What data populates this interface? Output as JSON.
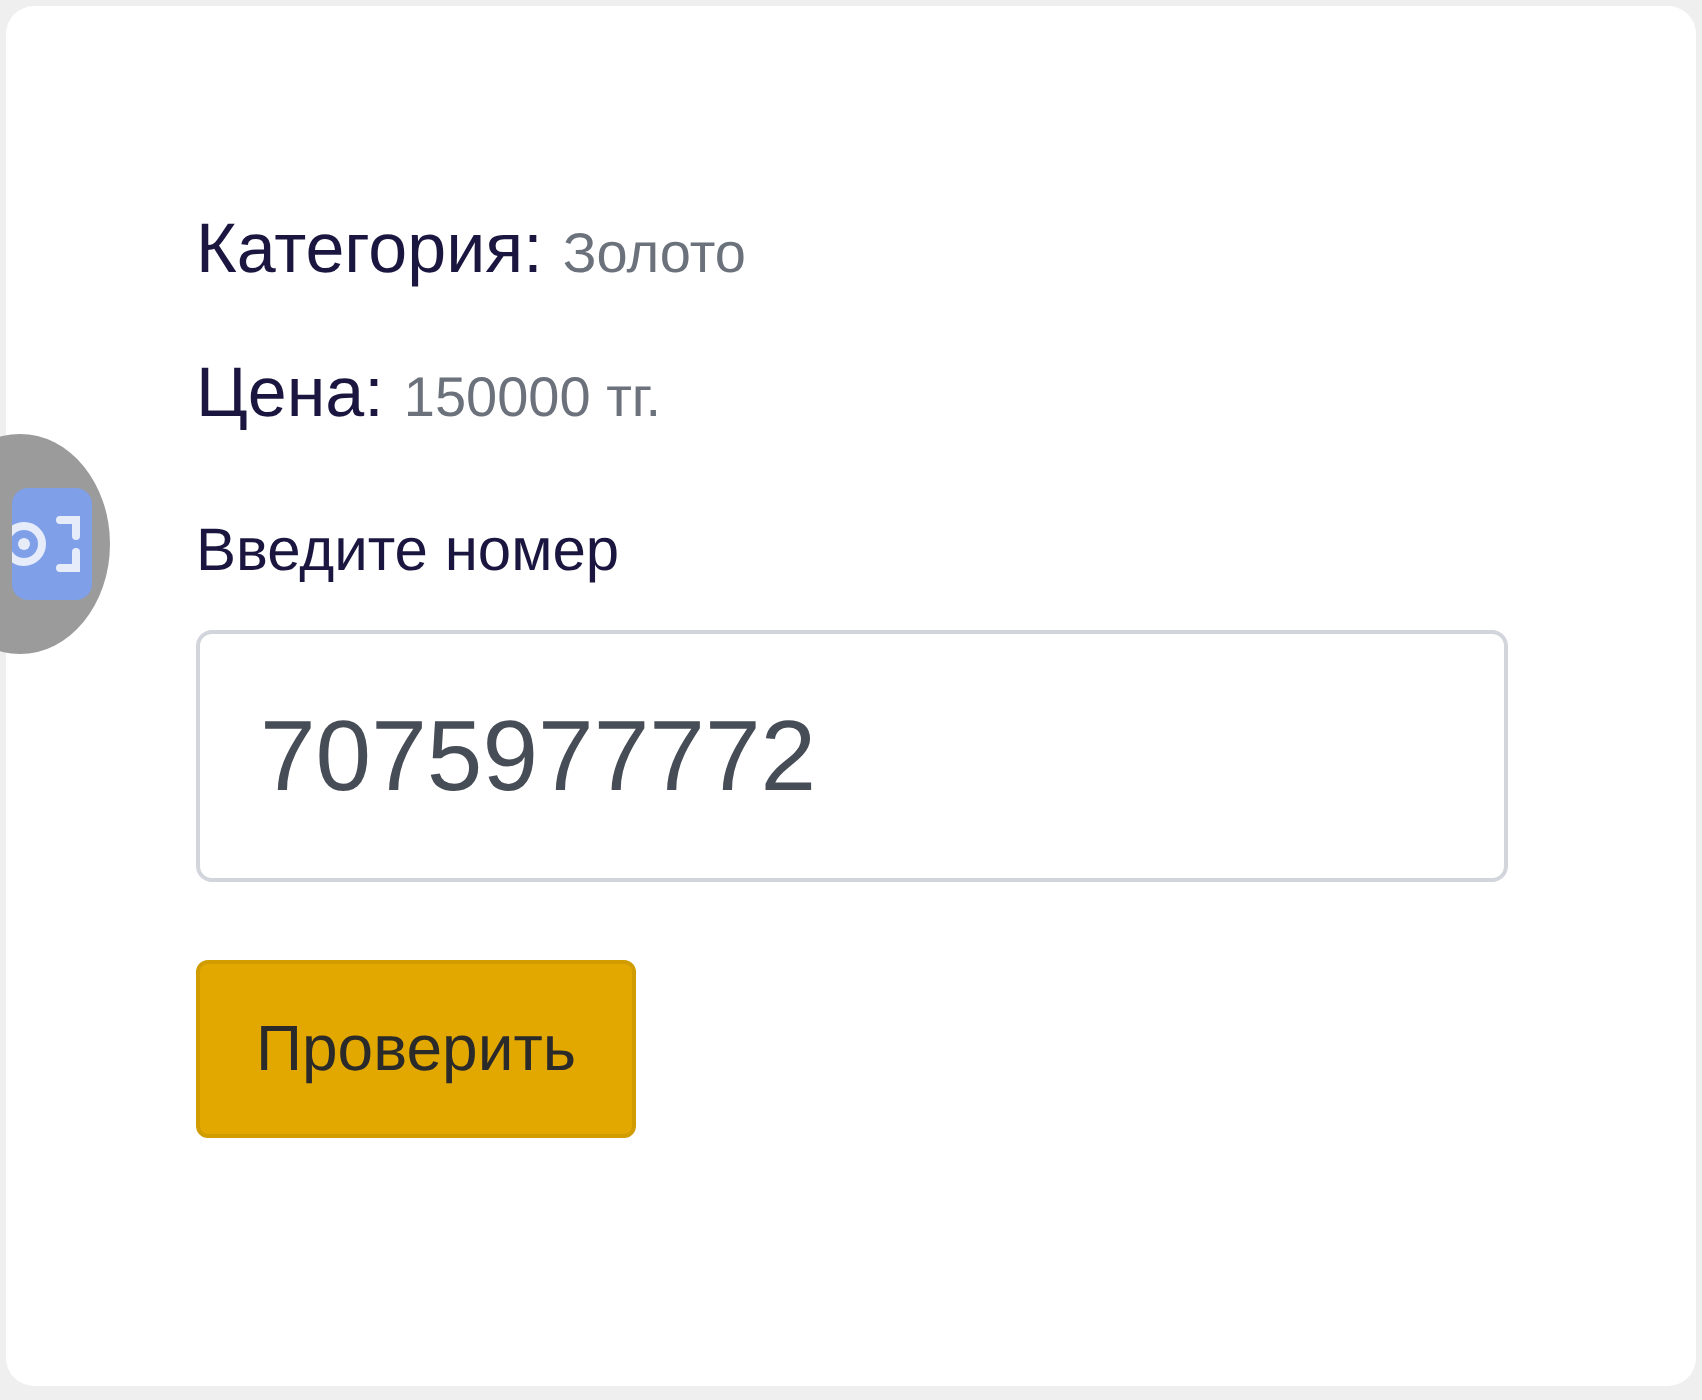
{
  "details": [
    {
      "label": "Категория:",
      "value": "Золото"
    },
    {
      "label": "Цена:",
      "value": "150000 тг."
    }
  ],
  "phone": {
    "label": "Введите номер",
    "value": "7075977772"
  },
  "check_button": "Проверить"
}
